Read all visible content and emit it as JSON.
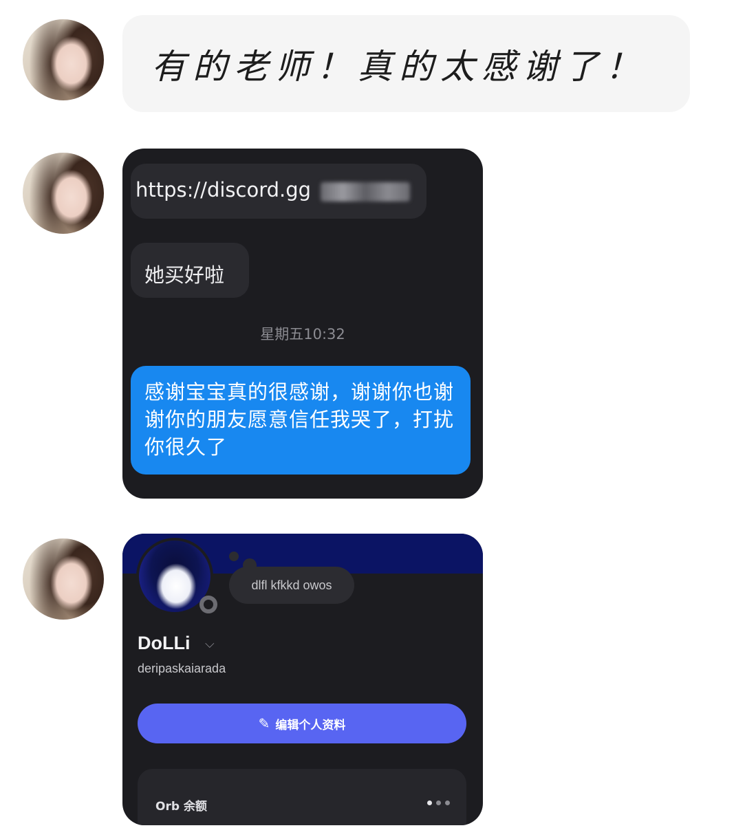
{
  "messages": {
    "handwritten_text": "有的老师！真的太感谢了！"
  },
  "screenshot1": {
    "link_text": "https://discord.gg",
    "message_text": "她买好啦",
    "timestamp": "星期五10:32",
    "reply_text": "感谢宝宝真的很感谢，谢谢你也谢谢你的朋友愿意信任我哭了，打扰你很久了"
  },
  "screenshot2": {
    "note_text": "dlfl  kfkkd  owos",
    "display_name": "DoLLi",
    "username": "deripaskaiarada",
    "edit_button_label": "编辑个人资料",
    "orb_label": "Orb 余额"
  },
  "icons": {
    "pencil": "pencil-icon",
    "chevron": "chevron-down-icon",
    "more": "more-dots-icon"
  },
  "colors": {
    "reply_bubble": "#1888f0",
    "edit_button": "#5865f2",
    "banner": "#0b1464",
    "card_bg": "#1c1c20"
  }
}
